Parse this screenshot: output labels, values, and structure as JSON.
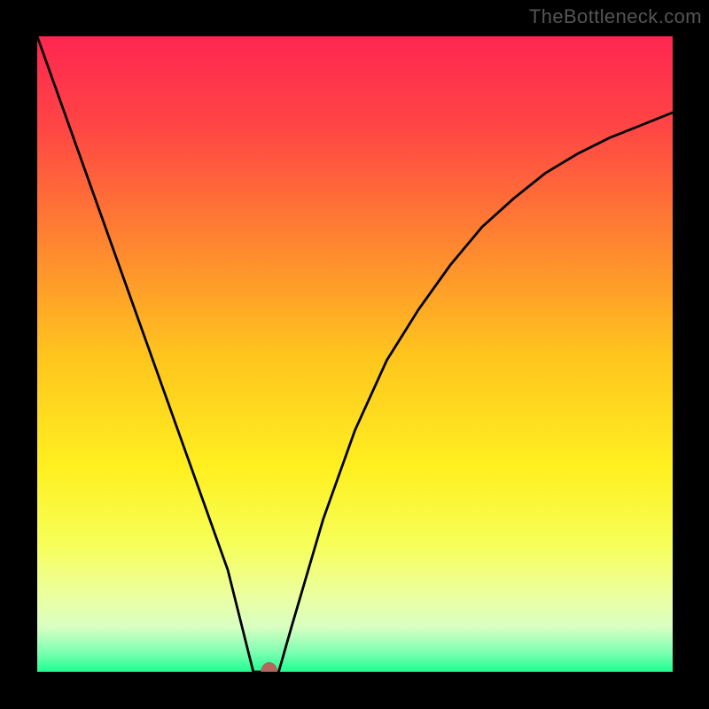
{
  "watermark": "TheBottleneck.com",
  "chart_data": {
    "type": "line",
    "title": "",
    "xlabel": "",
    "ylabel": "",
    "xlim": [
      0,
      100
    ],
    "ylim": [
      0,
      100
    ],
    "x_optimum": 36,
    "series": [
      {
        "name": "bottleneck-curve",
        "x": [
          0,
          5,
          10,
          15,
          20,
          25,
          30,
          33,
          34,
          36,
          38,
          40,
          45,
          50,
          55,
          60,
          65,
          70,
          75,
          80,
          85,
          90,
          95,
          100
        ],
        "y": [
          100,
          86,
          72,
          58,
          44,
          30,
          16,
          4,
          0,
          0,
          0,
          7,
          24,
          38,
          49,
          57,
          64,
          70,
          74.5,
          78.5,
          81.5,
          84,
          86,
          88
        ]
      }
    ],
    "marker": {
      "x": 36.5,
      "y": 0,
      "color": "#b3655e"
    },
    "gradient_stops": [
      {
        "offset": 0,
        "color": "#ff2650"
      },
      {
        "offset": 14,
        "color": "#ff4545"
      },
      {
        "offset": 30,
        "color": "#ff7c33"
      },
      {
        "offset": 50,
        "color": "#ffc41e"
      },
      {
        "offset": 68,
        "color": "#fff020"
      },
      {
        "offset": 80,
        "color": "#f6ff59"
      },
      {
        "offset": 88,
        "color": "#ecffa0"
      },
      {
        "offset": 93,
        "color": "#d8ffc3"
      },
      {
        "offset": 97,
        "color": "#7cffb0"
      },
      {
        "offset": 100,
        "color": "#1eff91"
      }
    ]
  }
}
